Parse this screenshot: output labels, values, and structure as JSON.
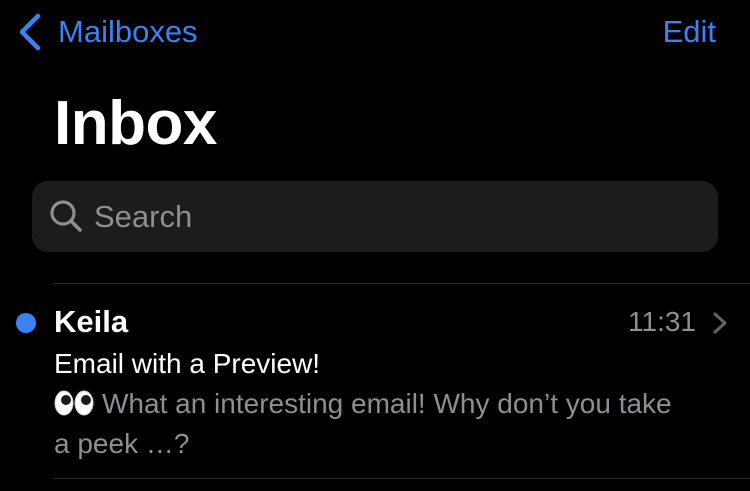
{
  "nav": {
    "back_label": "Mailboxes",
    "edit_label": "Edit"
  },
  "title": "Inbox",
  "search": {
    "placeholder": "Search"
  },
  "messages": [
    {
      "sender": "Keila",
      "time": "11:31",
      "subject": "Email with a Preview!",
      "preview_icon": "eyes-icon",
      "preview": "What an interesting email! Why don’t you take a peek …?",
      "unread": true
    }
  ],
  "colors": {
    "background": "#000000",
    "accent": "#3b82f6",
    "search_field": "#1c1c1e",
    "secondary_text": "#8e8e93",
    "separator": "#2c2c2e"
  }
}
